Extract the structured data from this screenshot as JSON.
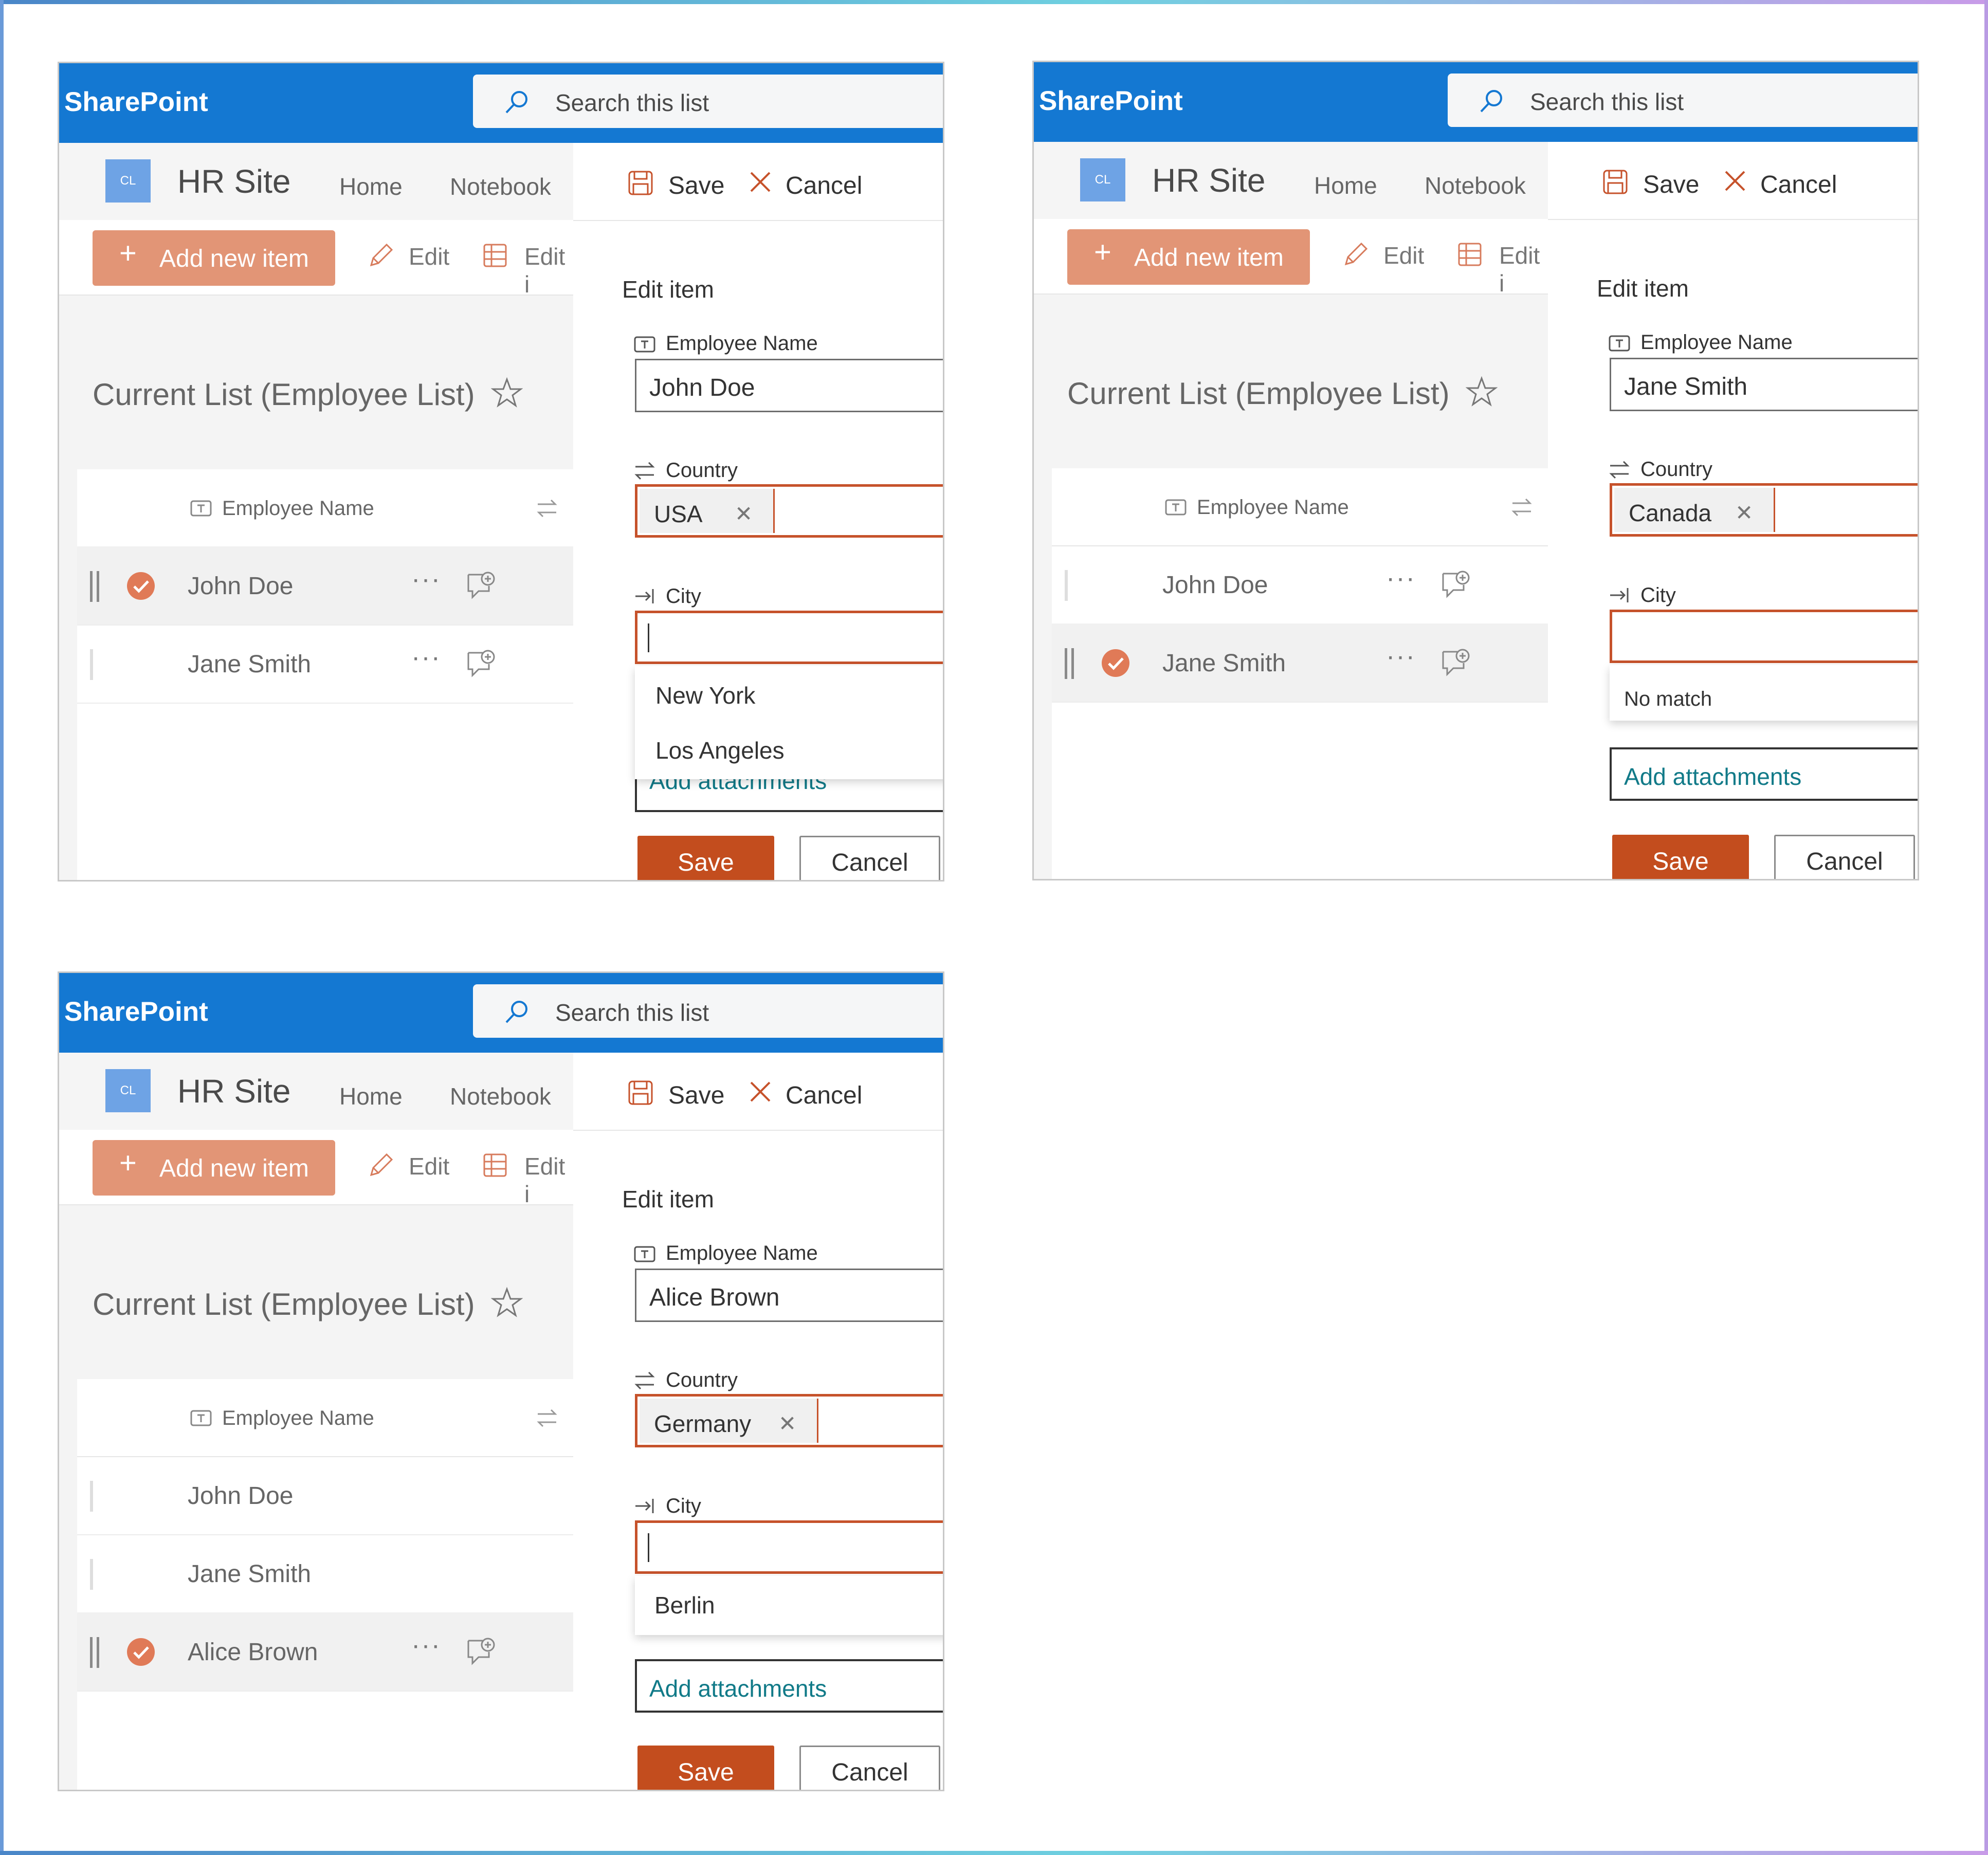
{
  "panels": [
    {
      "brand": "SharePoint",
      "search_placeholder": "Search this list",
      "site_logo": "CL",
      "site_title": "HR Site",
      "nav": [
        "Home",
        "Notebook"
      ],
      "toolbar": {
        "add": "Add new item",
        "edit": "Edit",
        "edit_grid": "Edit i"
      },
      "list_title": "Current List (Employee List)",
      "column": "Employee Name",
      "rows": [
        {
          "name": "John Doe",
          "selected": true
        },
        {
          "name": "Jane Smith",
          "selected": false
        }
      ],
      "form": {
        "save": "Save",
        "cancel": "Cancel",
        "heading": "Edit item",
        "employee_label": "Employee Name",
        "employee_value": "John Doe",
        "country_label": "Country",
        "country_value": "USA",
        "city_label": "City",
        "suggestions": [
          "New York",
          "Los Angeles"
        ],
        "attach_partial": "Add attachments",
        "btn_save": "Save",
        "btn_cancel": "Cancel"
      }
    },
    {
      "brand": "SharePoint",
      "search_placeholder": "Search this list",
      "site_logo": "CL",
      "site_title": "HR Site",
      "nav": [
        "Home",
        "Notebook"
      ],
      "toolbar": {
        "add": "Add new item",
        "edit": "Edit",
        "edit_grid": "Edit i"
      },
      "list_title": "Current List (Employee List)",
      "column": "Employee Name",
      "rows": [
        {
          "name": "John Doe",
          "selected": false
        },
        {
          "name": "Jane Smith",
          "selected": true
        }
      ],
      "form": {
        "save": "Save",
        "cancel": "Cancel",
        "heading": "Edit item",
        "employee_label": "Employee Name",
        "employee_value": "Jane Smith",
        "country_label": "Country",
        "country_value": "Canada",
        "city_label": "City",
        "no_match": "No match",
        "attach": "Add attachments",
        "btn_save": "Save",
        "btn_cancel": "Cancel"
      }
    },
    {
      "brand": "SharePoint",
      "search_placeholder": "Search this list",
      "site_logo": "CL",
      "site_title": "HR Site",
      "nav": [
        "Home",
        "Notebook"
      ],
      "toolbar": {
        "add": "Add new item",
        "edit": "Edit",
        "edit_grid": "Edit i"
      },
      "list_title": "Current List (Employee List)",
      "column": "Employee Name",
      "rows": [
        {
          "name": "John Doe",
          "selected": false
        },
        {
          "name": "Jane Smith",
          "selected": false
        },
        {
          "name": "Alice Brown",
          "selected": true
        }
      ],
      "form": {
        "save": "Save",
        "cancel": "Cancel",
        "heading": "Edit item",
        "employee_label": "Employee Name",
        "employee_value": "Alice Brown",
        "country_label": "Country",
        "country_value": "Germany",
        "city_label": "City",
        "suggestions": [
          "Berlin"
        ],
        "attach": "Add attachments",
        "btn_save": "Save",
        "btn_cancel": "Cancel"
      }
    }
  ],
  "colors": {
    "suite_bar": "#1478d2",
    "accent": "#c34d1e",
    "add_button": "#e29576",
    "link": "#117a88"
  }
}
